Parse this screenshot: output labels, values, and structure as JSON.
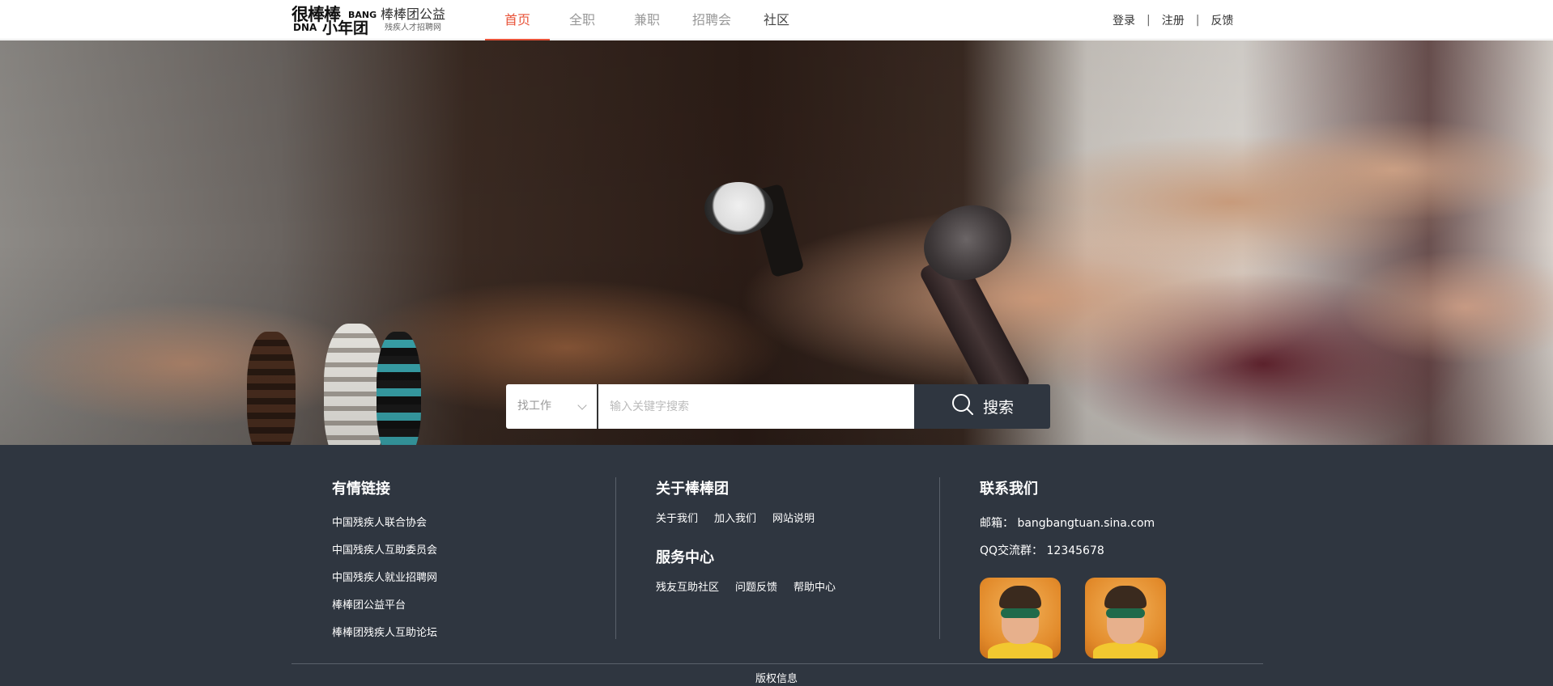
{
  "header": {
    "logo": {
      "mark_line1": "很棒棒",
      "mark_bang": "BANG",
      "mark_dna": "DNA",
      "mark_line2": "小年团",
      "title": "棒棒团公益",
      "subtitle": "残疾人才招聘网"
    },
    "nav": [
      {
        "label": "首页",
        "active": true
      },
      {
        "label": "全职",
        "active": false
      },
      {
        "label": "兼职",
        "active": false
      },
      {
        "label": "招聘会",
        "active": false
      },
      {
        "label": "社区",
        "active": false
      }
    ],
    "user_links": {
      "login": "登录",
      "separator": "|",
      "register": "注册",
      "feedback": "反馈"
    }
  },
  "search": {
    "category": "找工作",
    "placeholder": "输入关键字搜索",
    "button_label": "搜索"
  },
  "footer": {
    "friends": {
      "title": "有情链接",
      "links": [
        "中国残疾人联合协会",
        "中国残疾人互助委员会",
        "中国残疾人就业招聘网",
        "棒棒团公益平台",
        "棒棒团残疾人互助论坛"
      ]
    },
    "about": {
      "title": "关于棒棒团",
      "links": [
        "关于我们",
        "加入我们",
        "网站说明"
      ]
    },
    "service": {
      "title": "服务中心",
      "links": [
        "残友互助社区",
        "问题反馈",
        "帮助中心"
      ]
    },
    "contact": {
      "title": "联系我们",
      "email_label": "邮箱：",
      "email": "bangbangtuan.sina.com",
      "qq_label": "QQ交流群：",
      "qq": "12345678"
    },
    "copyright": "版权信息"
  },
  "colors": {
    "accent": "#e8543a",
    "footer_bg": "#2f3640",
    "search_button": "#2f3640"
  }
}
